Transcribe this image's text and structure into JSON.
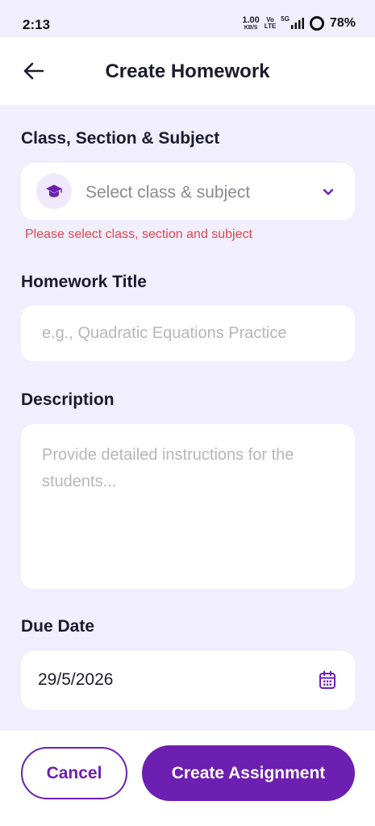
{
  "status_bar": {
    "time": "2:13",
    "net_speed_value": "1.00",
    "net_speed_unit": "KB/S",
    "volte_top": "Vo",
    "volte_bottom": "LTE",
    "signal_label": "5G",
    "battery": "78%"
  },
  "header": {
    "title": "Create Homework",
    "back_icon": "arrow-left-icon"
  },
  "form": {
    "class_section": {
      "label": "Class, Section & Subject",
      "placeholder": "Select class & subject",
      "icon": "graduation-cap-icon",
      "error": "Please select class, section and subject"
    },
    "title": {
      "label": "Homework Title",
      "placeholder": "e.g., Quadratic Equations Practice",
      "value": ""
    },
    "description": {
      "label": "Description",
      "placeholder": "Provide detailed instructions for the students...",
      "value": ""
    },
    "due_date": {
      "label": "Due Date",
      "value": "29/5/2026",
      "icon": "calendar-icon"
    }
  },
  "actions": {
    "cancel_label": "Cancel",
    "create_label": "Create Assignment"
  },
  "colors": {
    "accent": "#6c1fb0",
    "background": "#f1eefd",
    "error": "#e0484c"
  }
}
